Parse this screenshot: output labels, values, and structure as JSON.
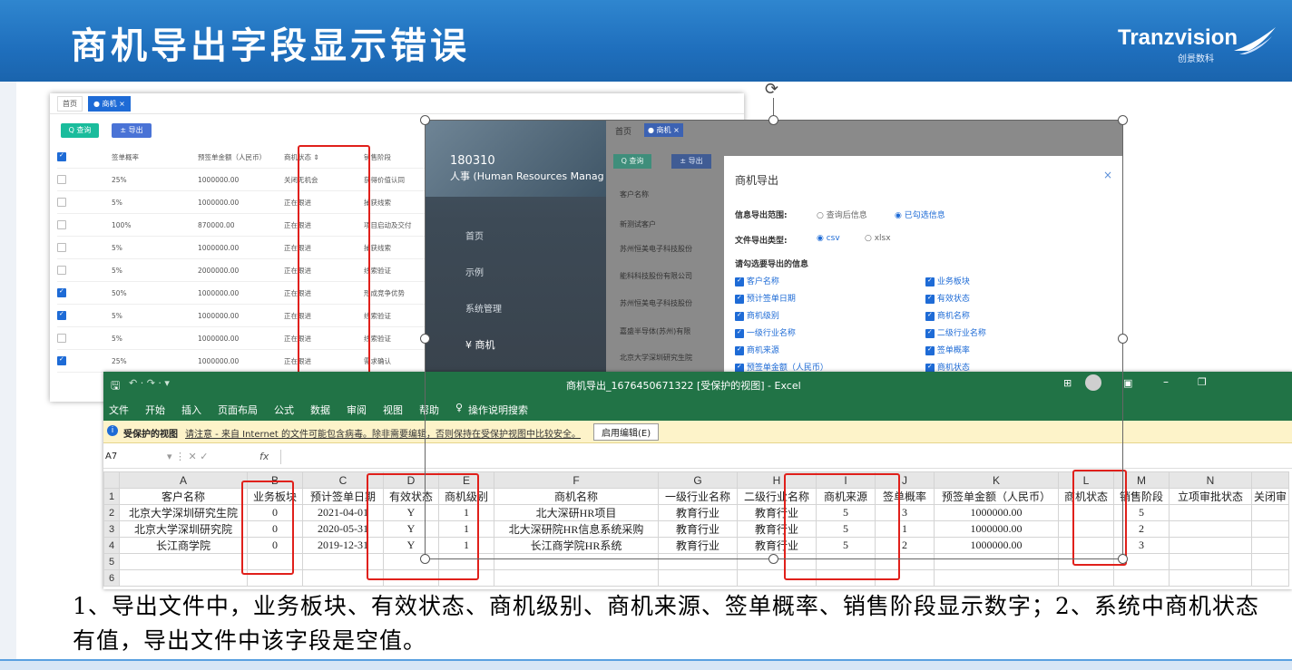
{
  "header": {
    "title": "商机导出字段显示错误",
    "logo": "Tranzvision",
    "logo_sub": "创景数科"
  },
  "shot1": {
    "tabs": [
      "首页",
      "● 商机 ×"
    ],
    "query_btn": "Q 查询",
    "export_btn": "± 导出",
    "columns": [
      "签单概率",
      "预签单金额（人民币）",
      "商机状态 ⇕",
      "销售阶段"
    ],
    "rows": [
      {
        "checked": false,
        "prob": "25%",
        "amount": "1000000.00",
        "status": "关闭无机会",
        "stage": "获得价值认同"
      },
      {
        "checked": false,
        "prob": "5%",
        "amount": "1000000.00",
        "status": "正在跟进",
        "stage": "捕获线索"
      },
      {
        "checked": false,
        "prob": "100%",
        "amount": "870000.00",
        "status": "正在跟进",
        "stage": "项目启动及交付"
      },
      {
        "checked": false,
        "prob": "5%",
        "amount": "1000000.00",
        "status": "正在跟进",
        "stage": "捕获线索"
      },
      {
        "checked": false,
        "prob": "5%",
        "amount": "2000000.00",
        "status": "正在跟进",
        "stage": "线索验证"
      },
      {
        "checked": true,
        "prob": "50%",
        "amount": "1000000.00",
        "status": "正在跟进",
        "stage": "形成竞争优势"
      },
      {
        "checked": true,
        "prob": "5%",
        "amount": "1000000.00",
        "status": "正在跟进",
        "stage": "线索验证"
      },
      {
        "checked": false,
        "prob": "5%",
        "amount": "1000000.00",
        "status": "正在跟进",
        "stage": "线索验证"
      },
      {
        "checked": true,
        "prob": "25%",
        "amount": "1000000.00",
        "status": "正在跟进",
        "stage": "需求确认"
      }
    ]
  },
  "shot2": {
    "sys_code": "180310",
    "sys_name": "人事 (Human Resources Manag",
    "nav": [
      "首页",
      "示例",
      "系统管理",
      "¥ 商机"
    ],
    "tabs": [
      "首页",
      "● 商机 ×"
    ],
    "query_btn": "Q 查询",
    "export_btn": "± 导出",
    "col_customer": "客户名称",
    "customers": [
      "新测试客户",
      "苏州恒美电子科技股份",
      "能科科技股份有限公司",
      "苏州恒美电子科技股份",
      "嘉盛半导体(苏州)有限",
      "北京大学深圳研究生院"
    ],
    "dialog": {
      "title": "商机导出",
      "range_label": "信息导出范围:",
      "range_opts": [
        "查询后信息",
        "已勾选信息"
      ],
      "type_label": "文件导出类型:",
      "type_opts": [
        "csv",
        "xlsx"
      ],
      "fields_label": "请勾选要导出的信息",
      "fields_left": [
        "客户名称",
        "预计签单日期",
        "商机级别",
        "一级行业名称",
        "商机来源",
        "预签单金额（人民币）"
      ],
      "fields_right": [
        "业务板块",
        "有效状态",
        "商机名称",
        "二级行业名称",
        "签单概率",
        "商机状态"
      ]
    }
  },
  "excel": {
    "title": "商机导出_1676450671322  [受保护的视图]  -  Excel",
    "menu": [
      "文件",
      "开始",
      "插入",
      "页面布局",
      "公式",
      "数据",
      "审阅",
      "视图",
      "帮助",
      "操作说明搜索"
    ],
    "warn_label": "受保护的视图",
    "warn_text": "请注意 - 来自 Internet 的文件可能包含病毒。除非需要编辑，否则保持在受保护视图中比较安全。",
    "enable_btn": "启用编辑(E)",
    "cell_ref": "A7",
    "fx": "fx",
    "col_letters": [
      "A",
      "B",
      "C",
      "D",
      "E",
      "F",
      "G",
      "H",
      "I",
      "J",
      "K",
      "L",
      "M",
      "N"
    ],
    "headers": [
      "客户名称",
      "业务板块",
      "预计签单日期",
      "有效状态",
      "商机级别",
      "商机名称",
      "一级行业名称",
      "二级行业名称",
      "商机来源",
      "签单概率",
      "预签单金额（人民币）",
      "商机状态",
      "销售阶段",
      "立项审批状态",
      "关闭审"
    ],
    "rows": [
      [
        "北京大学深圳研究生院",
        "0",
        "2021-04-01",
        "Y",
        "1",
        "北大深研HR项目",
        "教育行业",
        "教育行业",
        "5",
        "3",
        "1000000.00",
        "",
        "5",
        ""
      ],
      [
        "北京大学深圳研究院",
        "0",
        "2020-05-31",
        "Y",
        "1",
        "北大深研院HR信息系统采购",
        "教育行业",
        "教育行业",
        "5",
        "1",
        "1000000.00",
        "",
        "2",
        ""
      ],
      [
        "长江商学院",
        "0",
        "2019-12-31",
        "Y",
        "1",
        "长江商学院HR系统",
        "教育行业",
        "教育行业",
        "5",
        "2",
        "1000000.00",
        "",
        "3",
        ""
      ]
    ],
    "row_nums": [
      "1",
      "2",
      "3",
      "4",
      "5",
      "6"
    ]
  },
  "caption": "1、导出文件中，业务板块、有效状态、商机级别、商机来源、签单概率、销售阶段显示数字；2、系统中商机状态有值，导出文件中该字段是空值。"
}
